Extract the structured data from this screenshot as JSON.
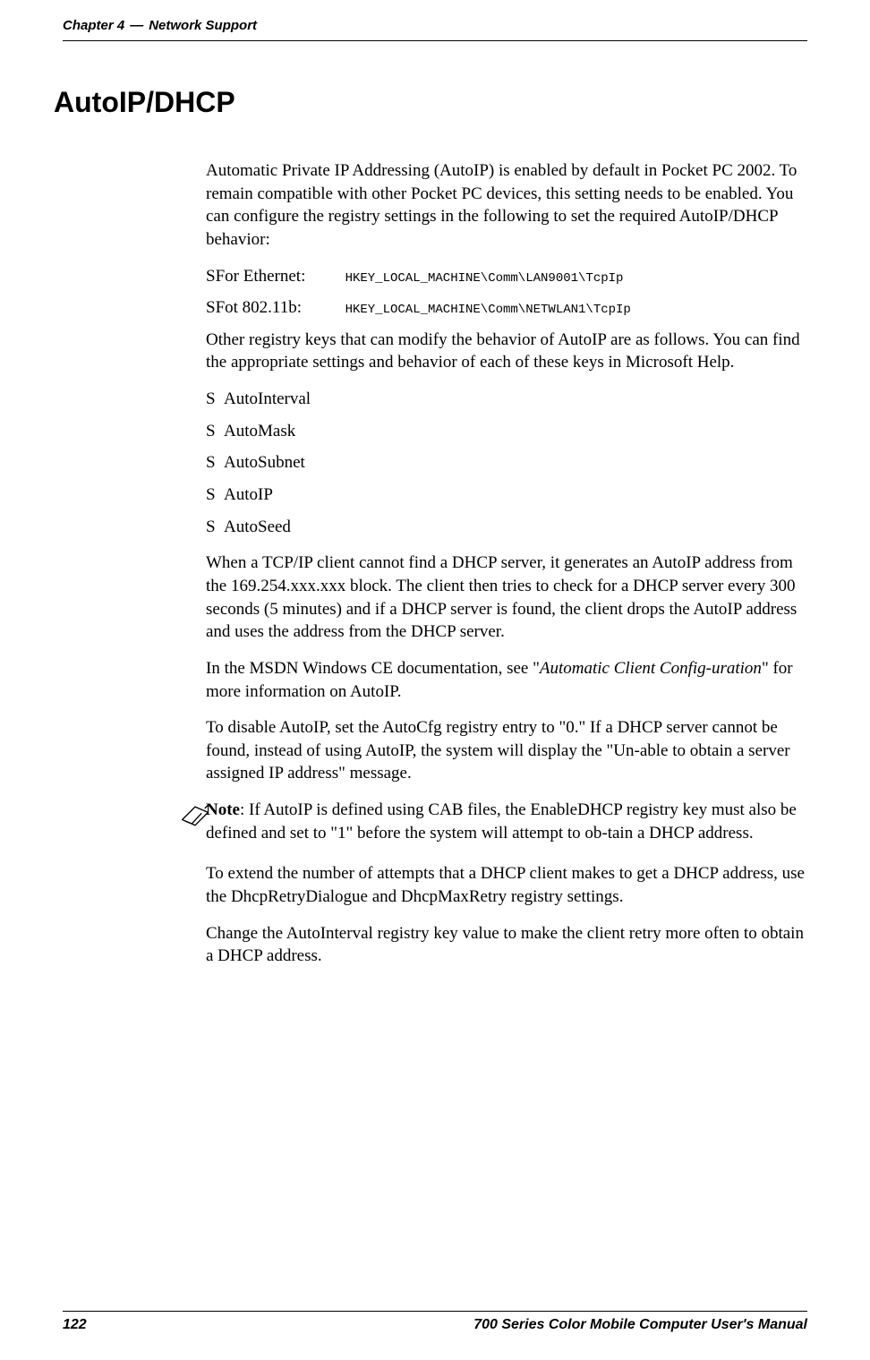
{
  "header": {
    "chapter": "Chapter 4",
    "dash": "—",
    "title": "Network Support"
  },
  "heading": "AutoIP/DHCP",
  "paragraphs": {
    "p1": "Automatic Private IP Addressing (AutoIP) is enabled by default in Pocket PC 2002. To remain compatible with other Pocket PC devices, this setting needs to be enabled. You can configure the registry settings in the following to set the required AutoIP/DHCP behavior:",
    "p2": "Other registry keys that can modify the behavior of AutoIP are as follows. You can find the appropriate settings and behavior of each of these keys in Microsoft Help.",
    "p3": "When a TCP/IP client cannot find a DHCP server, it generates an AutoIP address from the 169.254.xxx.xxx block. The client then tries to check for a DHCP server every 300 seconds (5 minutes) and if a DHCP server is found, the client drops the AutoIP address and uses the address from the DHCP server.",
    "p4_prefix": "In the MSDN Windows CE documentation, see \"",
    "p4_italic": "Automatic Client Config-uration",
    "p4_suffix": "\" for more information on AutoIP.",
    "p5": "To disable AutoIP, set the AutoCfg registry entry to \"0.\" If a DHCP server cannot be found, instead of using AutoIP, the system will display the \"Un-able to obtain a server assigned IP address\" message.",
    "p6": "To extend the number of attempts that a DHCP client makes to get a DHCP address, use the DhcpRetryDialogue and DhcpMaxRetry registry settings.",
    "p7": "Change the AutoInterval registry key value to make the client retry more often to obtain a DHCP address."
  },
  "registry": {
    "ethernet_label": "For Ethernet:",
    "ethernet_key": "HKEY_LOCAL_MACHINE\\Comm\\LAN9001\\TcpIp",
    "wifi_label": "Fot 802.11b:",
    "wifi_key": "HKEY_LOCAL_MACHINE\\Comm\\NETWLAN1\\TcpIp"
  },
  "registry_keys_list": [
    "AutoInterval",
    "AutoMask",
    "AutoSubnet",
    "AutoIP",
    "AutoSeed"
  ],
  "note": {
    "label": "Note",
    "text": ": If AutoIP is defined using CAB files, the EnableDHCP registry key must also be defined and set to \"1\" before the system will attempt to ob-tain a DHCP address."
  },
  "footer": {
    "page_number": "122",
    "manual_title": "700 Series Color Mobile Computer User's Manual"
  },
  "bullet_char": "S"
}
